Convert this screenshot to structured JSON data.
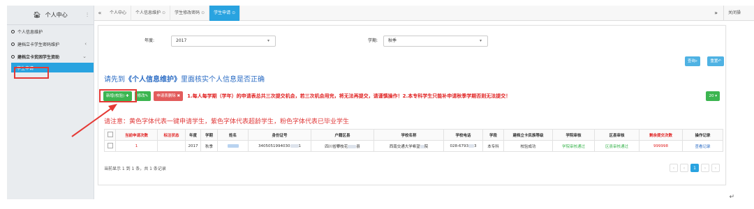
{
  "sidebar": {
    "title": "个人中心",
    "toggle": "⫶",
    "items": [
      {
        "label": "个人信息维护"
      },
      {
        "label": "建档立卡学生密码维护",
        "chevron": "‹"
      },
      {
        "label": "建档立卡贫困学生资助",
        "chevron": "⌄"
      }
    ],
    "sub_active": "学生申请"
  },
  "tabs": {
    "back": "«",
    "items": [
      {
        "label": "个人中心",
        "close": ""
      },
      {
        "label": "个人信息维护",
        "close": "⊙"
      },
      {
        "label": "学生修改密码",
        "close": "⊙"
      },
      {
        "label": "学生申请",
        "close": "⊙"
      }
    ],
    "forward": "»",
    "close_all": "关闭操"
  },
  "filters": {
    "year_label": "年度:",
    "year_value": "2017",
    "term_label": "学期:",
    "term_value": "秋季",
    "caret": "▾"
  },
  "actions": {
    "query": "查询",
    "reset": "重置"
  },
  "notice": {
    "prefix": "请先到",
    "link": "《个人信息维护》",
    "suffix": "里面核实个人信息是否正确"
  },
  "buttons": {
    "add": "新增(校验)",
    "edit": "修改",
    "submit": "申请表删除",
    "rule": "1.每人每学期（学年）的申请表总共三次提交机会，若三次机会用完，将无法再提交，请谨慎操作！2.本专科学生只能补申请秋季学期否则无法提交！",
    "count": "20"
  },
  "legend": "请注意：黄色字体代表一键申请学生，紫色字体代表超龄学生，粉色字体代表已毕业学生",
  "table": {
    "headers": [
      "",
      "当前申请次数",
      "标注状态",
      "年度",
      "学期",
      "姓名",
      "身份证号",
      "户籍区县",
      "学校名称",
      "学校电话",
      "学段",
      "建档立卡民族等级",
      "学院审核",
      "区县审核",
      "剩余提交次数",
      "操作记录"
    ],
    "rows": [
      {
        "count": "1",
        "status": "",
        "year": "2017",
        "term": "秋季",
        "id_prefix": "3405051994030",
        "id_suffix": "1",
        "district_a": "四川省攀枝花",
        "district_b": "县",
        "school": "西南交通大学希望",
        "school_suffix": "院",
        "phone_a": "028-6793",
        "phone_b": "3",
        "stage": "本专科",
        "level": "校验成功",
        "college_review": "学院审核通过",
        "county_review": "区县审核通过",
        "remaining": "999998",
        "log": "查看记录"
      }
    ]
  },
  "footer": {
    "summary": "当前显示 1 到 1 条，共 1 条记录"
  },
  "pager": {
    "first": "‹",
    "prev": "‹",
    "current": "1",
    "next": "›",
    "last": "›"
  },
  "colors": {
    "accent": "#29a3e0",
    "green": "#3cb550",
    "red": "#e02020",
    "link_blue": "#2b6cc4"
  }
}
